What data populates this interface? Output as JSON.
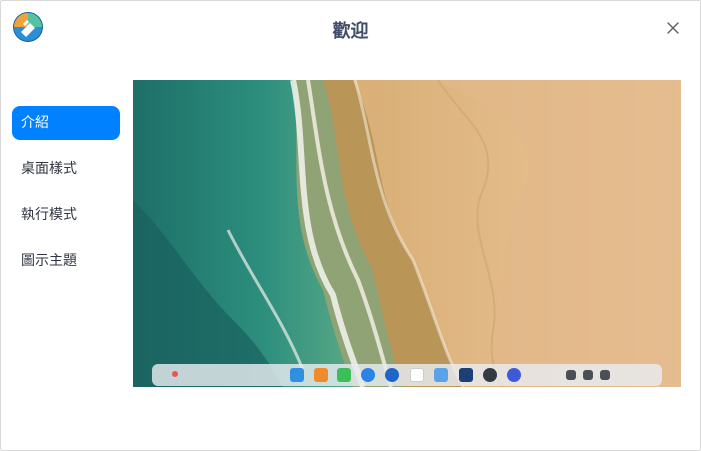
{
  "window": {
    "title": "歡迎"
  },
  "sidebar": {
    "items": [
      {
        "label": "介紹",
        "active": true
      },
      {
        "label": "桌面樣式",
        "active": false
      },
      {
        "label": "執行模式",
        "active": false
      },
      {
        "label": "圖示主題",
        "active": false
      }
    ]
  },
  "preview": {
    "description_icons": [
      "launcher-icon",
      "calendar-icon",
      "file-manager-icon",
      "settings-icon"
    ]
  },
  "colors": {
    "accent": "#0081ff",
    "title_text": "#414d68",
    "nav_text": "#303642"
  }
}
